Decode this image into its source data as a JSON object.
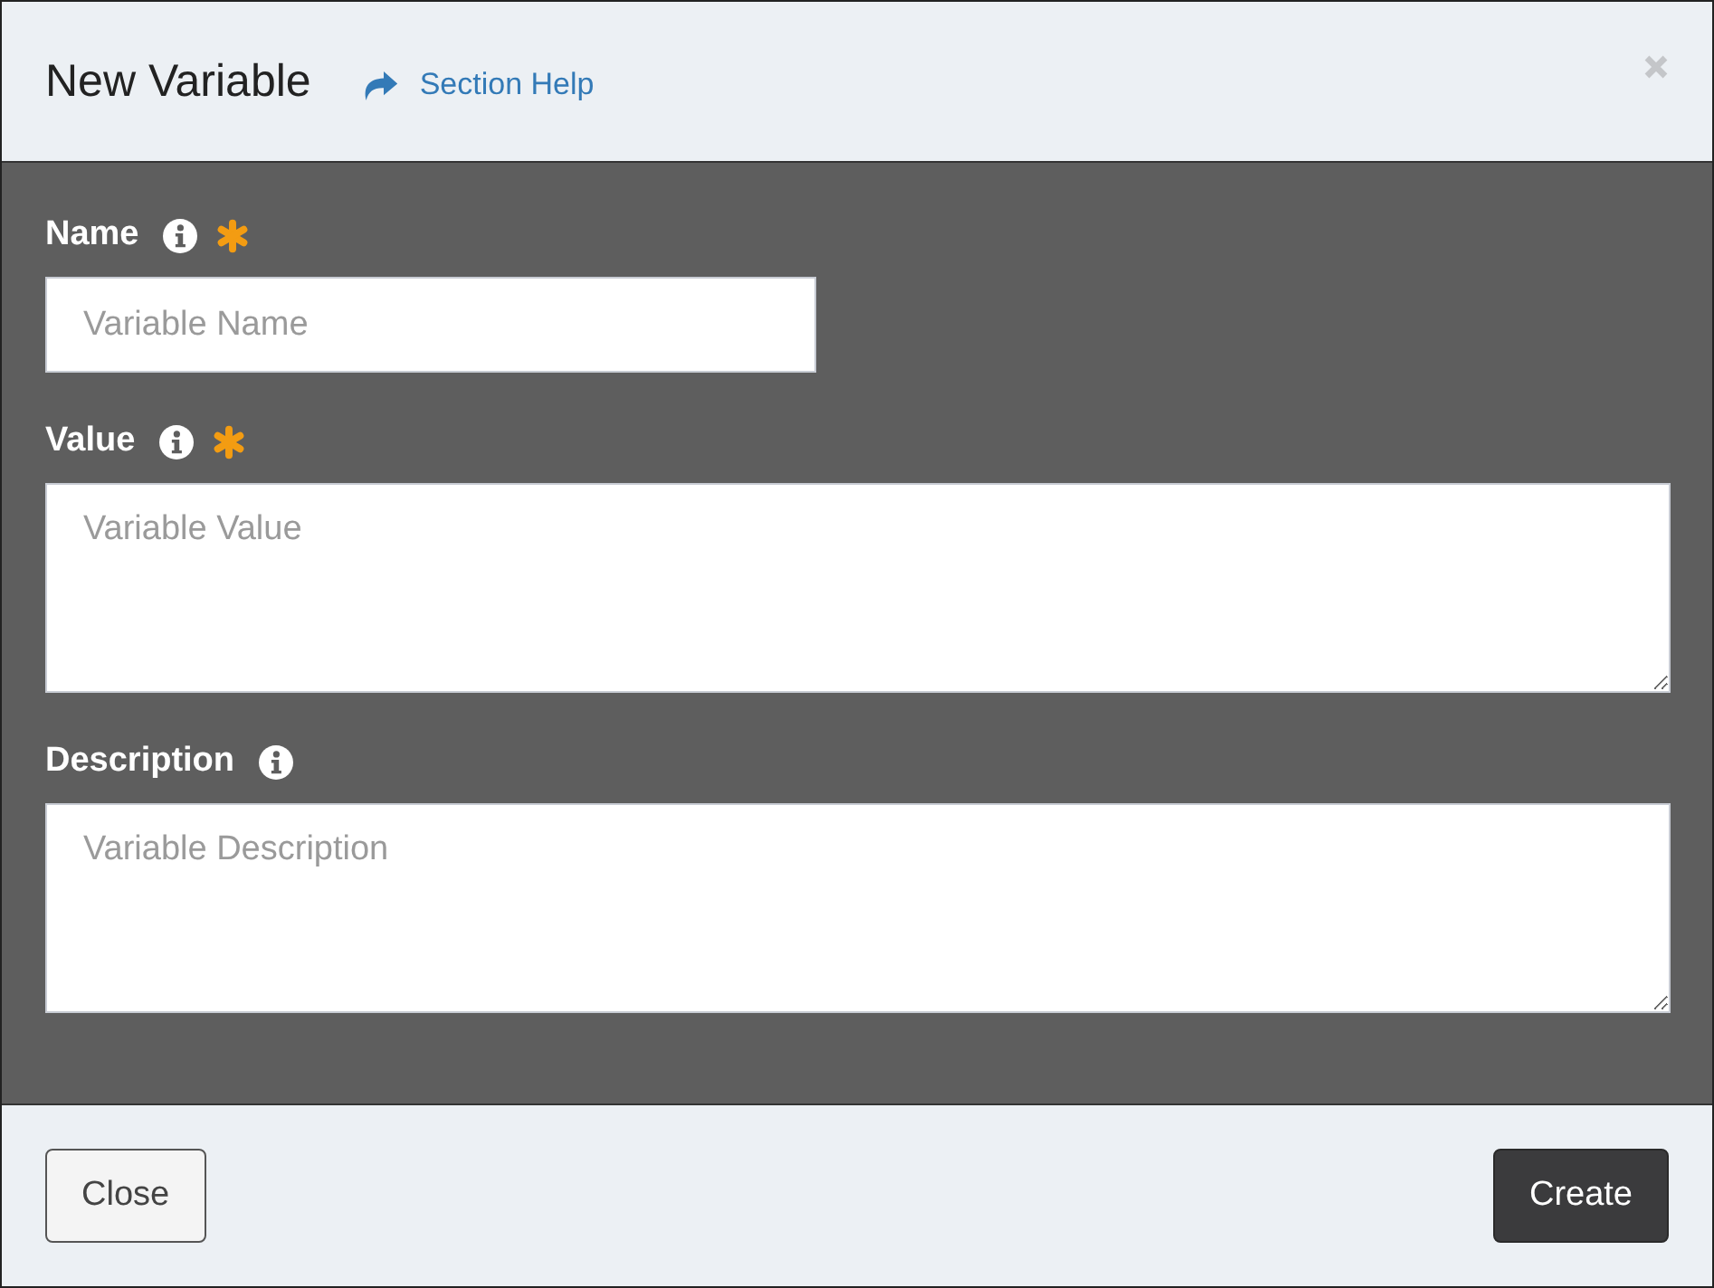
{
  "dialog": {
    "title": "New Variable",
    "help_link": "Section Help"
  },
  "fields": [
    {
      "label": "Name",
      "kind": "input",
      "required": true,
      "placeholder": "Variable Name"
    },
    {
      "label": "Value",
      "kind": "textarea",
      "required": true,
      "placeholder": "Variable Value"
    },
    {
      "label": "Description",
      "kind": "textarea",
      "required": false,
      "placeholder": "Variable Description"
    }
  ],
  "buttons": [
    {
      "label": "Close",
      "kind": "secondary"
    },
    {
      "label": "Create",
      "kind": "primary"
    }
  ]
}
